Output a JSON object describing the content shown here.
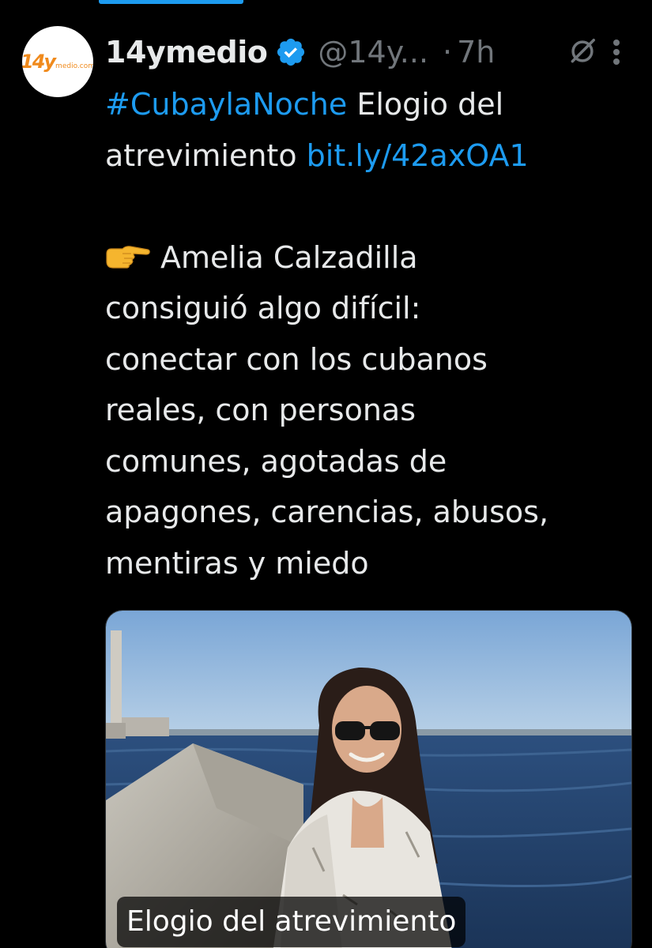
{
  "tweet": {
    "author": {
      "display_name": "14ymedio",
      "handle": "@14y...",
      "verified": true,
      "avatar_icon": "14ymedio-logo",
      "avatar_logo_num": "14y",
      "avatar_logo_text": "medio.com"
    },
    "separator": "·",
    "time": "7h",
    "text": {
      "hashtag": "#CubaylaNoche",
      "line1_rest": " Elogio del",
      "line2_text": "atrevimiento ",
      "link": "bit.ly/42axOA1",
      "emoji": "backhand-index-pointing-right",
      "body_line1": "Amelia Calzadilla",
      "body_line2": "consiguió algo difícil:",
      "body_line3": "conectar con los cubanos",
      "body_line4": "reales, con personas",
      "body_line5": "comunes, agotadas de",
      "body_line6": "apagones, carencias, abusos,",
      "body_line7": "mentiras y miedo"
    },
    "media": {
      "caption": "Elogio del atrevimiento"
    }
  },
  "colors": {
    "background": "#000000",
    "text": "#e7e9ea",
    "muted": "#71767b",
    "accent": "#1d9bf0"
  },
  "icons": {
    "verified": "verified-badge-icon",
    "grok": "grok-icon",
    "more": "more-vertical-icon"
  }
}
